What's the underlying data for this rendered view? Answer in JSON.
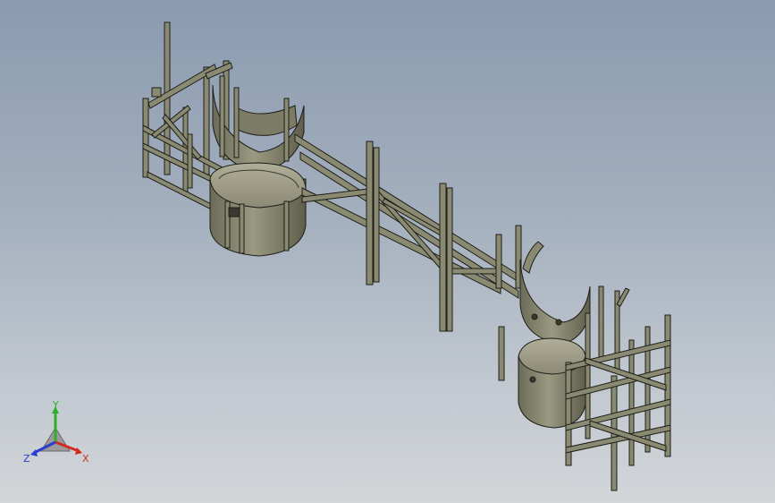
{
  "viewport": {
    "background_top": "#8b9ab0",
    "background_bottom": "#d3d6d9",
    "model_color": "#8a8a72",
    "edge_color": "#1e1e18"
  },
  "triad": {
    "x_label": "X",
    "y_label": "Y",
    "z_label": "Z",
    "x_color": "#d12a1e",
    "y_color": "#2fae2a",
    "z_color": "#2a3fd1"
  }
}
